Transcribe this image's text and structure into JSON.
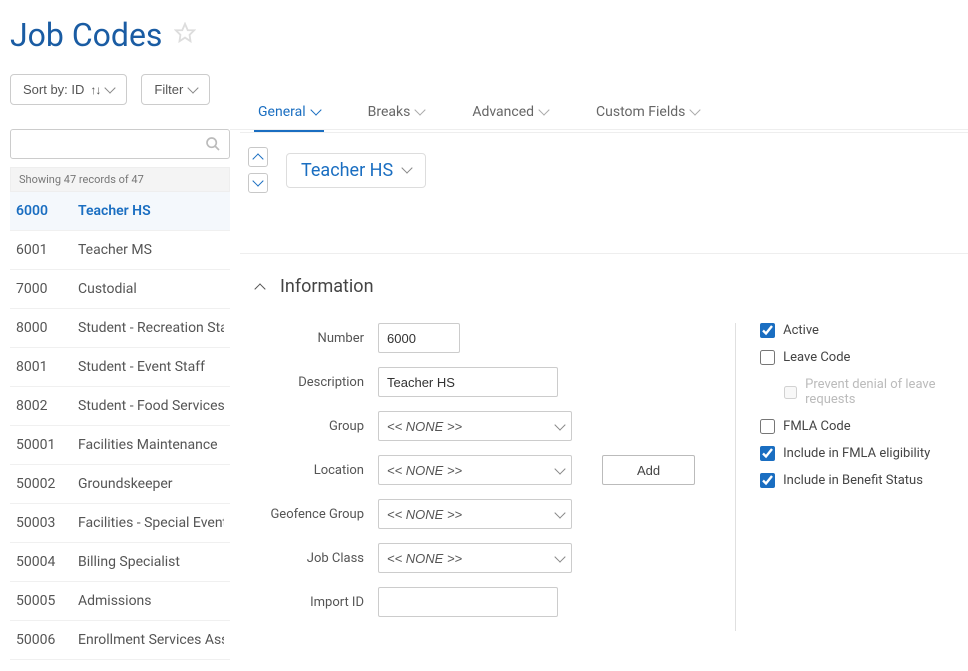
{
  "page": {
    "title": "Job Codes"
  },
  "toolbar": {
    "sort_label": "Sort by: ID",
    "filter_label": "Filter"
  },
  "sidebar": {
    "record_count": "Showing 47 records of 47",
    "records": [
      {
        "code": "6000",
        "label": "Teacher HS",
        "active": true
      },
      {
        "code": "6001",
        "label": "Teacher MS"
      },
      {
        "code": "7000",
        "label": "Custodial"
      },
      {
        "code": "8000",
        "label": "Student - Recreation Staff"
      },
      {
        "code": "8001",
        "label": "Student - Event Staff"
      },
      {
        "code": "8002",
        "label": "Student - Food Services"
      },
      {
        "code": "50001",
        "label": "Facilities Maintenance"
      },
      {
        "code": "50002",
        "label": "Groundskeeper"
      },
      {
        "code": "50003",
        "label": "Facilities - Special Events"
      },
      {
        "code": "50004",
        "label": "Billing Specialist"
      },
      {
        "code": "50005",
        "label": "Admissions"
      },
      {
        "code": "50006",
        "label": "Enrollment Services Assistant"
      }
    ]
  },
  "tabs": [
    {
      "label": "General",
      "active": true
    },
    {
      "label": "Breaks"
    },
    {
      "label": "Advanced"
    },
    {
      "label": "Custom Fields"
    }
  ],
  "detail": {
    "title": "Teacher HS"
  },
  "section": {
    "title": "Information",
    "form": {
      "number_label": "Number",
      "number_value": "6000",
      "description_label": "Description",
      "description_value": "Teacher HS",
      "group_label": "Group",
      "group_value": "<< NONE >>",
      "location_label": "Location",
      "location_value": "<< NONE >>",
      "add_label": "Add",
      "geofence_label": "Geofence Group",
      "geofence_value": "<< NONE >>",
      "jobclass_label": "Job Class",
      "jobclass_value": "<< NONE >>",
      "importid_label": "Import ID",
      "importid_value": ""
    },
    "checks": {
      "active": {
        "label": "Active",
        "checked": true
      },
      "leave_code": {
        "label": "Leave Code",
        "checked": false
      },
      "prevent_denial": {
        "label": "Prevent denial of leave requests",
        "checked": false,
        "disabled": true
      },
      "fmla_code": {
        "label": "FMLA Code",
        "checked": false
      },
      "fmla_elig": {
        "label": "Include in FMLA eligibility",
        "checked": true
      },
      "benefit": {
        "label": "Include in Benefit Status",
        "checked": true
      }
    }
  }
}
